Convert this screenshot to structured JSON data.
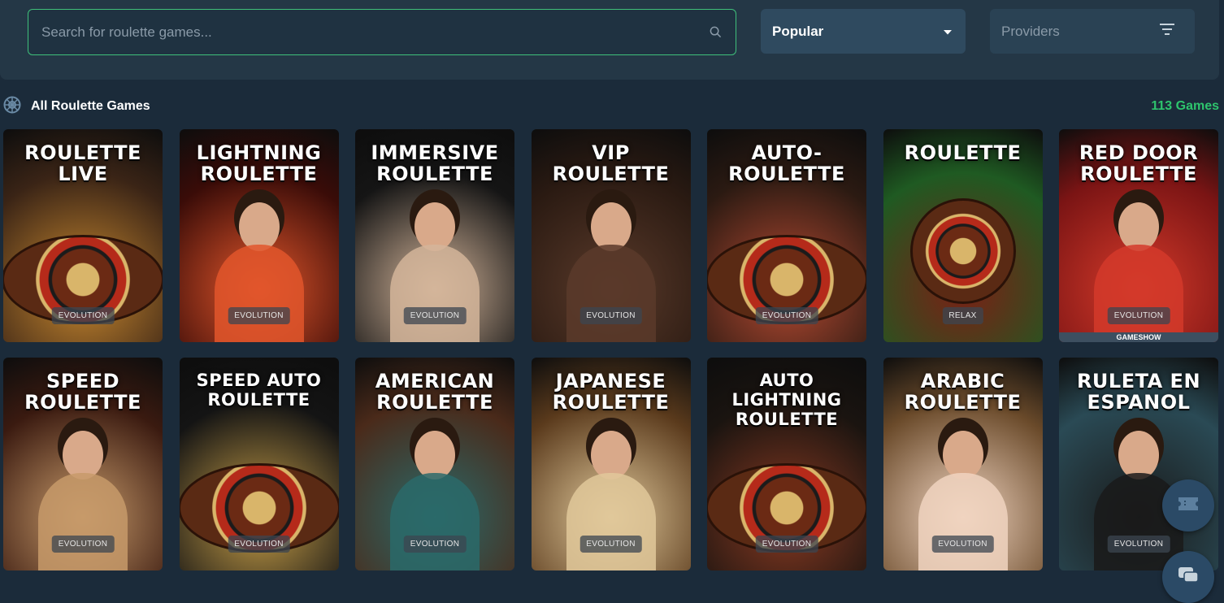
{
  "search": {
    "placeholder": "Search for roulette games..."
  },
  "sort": {
    "selected": "Popular"
  },
  "providers": {
    "label": "Providers"
  },
  "section": {
    "title": "All Roulette Games",
    "count": "113 Games"
  },
  "games": [
    {
      "title": "ROULETTE\nLIVE",
      "provider": "EVOLUTION",
      "bg": "#3a2416",
      "accent": "#c9892f"
    },
    {
      "title": "LIGHTNING\nROULETTE",
      "provider": "EVOLUTION",
      "bg": "#3a0c08",
      "accent": "#e2562b"
    },
    {
      "title": "IMMERSIVE\nROULETTE",
      "provider": "EVOLUTION",
      "bg": "#151515",
      "accent": "#d4b59a"
    },
    {
      "title": "VIP\nROULETTE",
      "provider": "EVOLUTION",
      "bg": "#2a1a12",
      "accent": "#5a3a2a"
    },
    {
      "title": "AUTO-ROULETTE",
      "provider": "EVOLUTION",
      "bg": "#2b1a12",
      "accent": "#b74a32"
    },
    {
      "title": "ROULETTE",
      "provider": "RELAX",
      "bg": "#1f5a22",
      "accent": "#7a2015"
    },
    {
      "title": "RED DOOR\nROULETTE",
      "provider": "EVOLUTION",
      "bg": "#7a1414",
      "accent": "#d43a2a",
      "band": "GAMESHOW"
    },
    {
      "title": "SPEED\nROULETTE",
      "provider": "EVOLUTION",
      "bg": "#3a1a10",
      "accent": "#c79a6a"
    },
    {
      "title": "SPEED AUTO\nROULETTE",
      "provider": "EVOLUTION",
      "bg": "#141414",
      "accent": "#c9a048"
    },
    {
      "title": "AMERICAN\nROULETTE",
      "provider": "EVOLUTION",
      "bg": "#4a2a1a",
      "accent": "#2a6a6a"
    },
    {
      "title": "JAPANESE\nROULETTE",
      "provider": "EVOLUTION",
      "bg": "#5a3a1c",
      "accent": "#e0c89a"
    },
    {
      "title": "AUTO LIGHTNING\nROULETTE",
      "provider": "EVOLUTION",
      "bg": "#1a1410",
      "accent": "#8a3a22"
    },
    {
      "title": "ARABIC\nROULETTE",
      "provider": "EVOLUTION",
      "bg": "#6a4a2a",
      "accent": "#f0d4c0"
    },
    {
      "title": "RULETA EN\nESPANOL",
      "provider": "EVOLUTION",
      "bg": "#2a4a55",
      "accent": "#1a1a1a"
    }
  ],
  "colors": {
    "accent_green": "#2ec46d",
    "panel": "#243746",
    "background": "#1b2b3a"
  },
  "icons": {
    "search": "search-icon",
    "dropdown": "caret-down-icon",
    "filter": "filter-icon",
    "section": "roulette-wheel-icon",
    "ticket": "ticket-icon",
    "chat": "chat-icon"
  }
}
